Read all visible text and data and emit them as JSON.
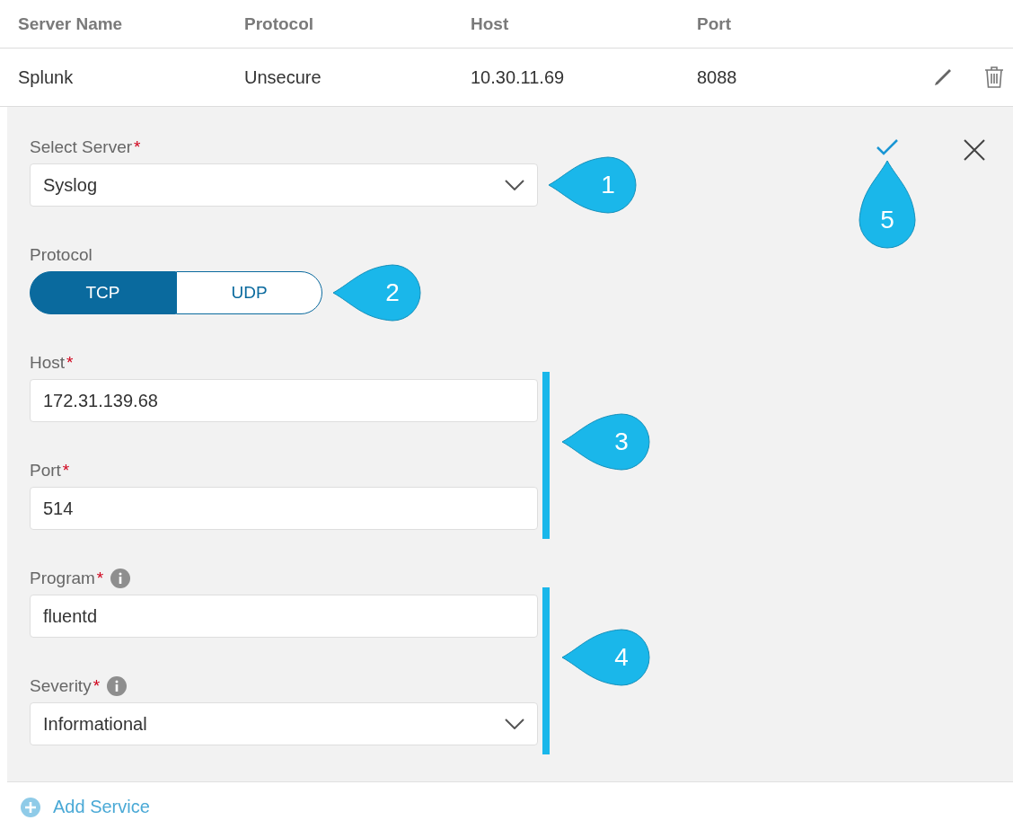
{
  "table": {
    "columns": [
      "Server Name",
      "Protocol",
      "Host",
      "Port"
    ],
    "rows": [
      {
        "cells": [
          "Splunk",
          "Unsecure",
          "10.30.11.69",
          "8088"
        ]
      }
    ]
  },
  "form": {
    "rows": [
      {
        "kind": "select",
        "label": "Select Server",
        "required_mark": "*",
        "info": false,
        "value": "Syslog",
        "callout": "1"
      },
      {
        "kind": "toggle",
        "label": "Protocol",
        "options": [
          {
            "label": "TCP",
            "selected": true
          },
          {
            "label": "UDP",
            "selected": false
          }
        ],
        "callout": "2"
      },
      {
        "kind": "group",
        "callout": "3",
        "fields": [
          {
            "kind": "text",
            "label": "Host",
            "required_mark": "*",
            "info": false,
            "value": "172.31.139.68"
          },
          {
            "kind": "text",
            "label": "Port",
            "required_mark": "*",
            "info": false,
            "value": "514"
          }
        ]
      },
      {
        "kind": "group",
        "callout": "4",
        "fields": [
          {
            "kind": "text",
            "label": "Program",
            "required_mark": "*",
            "info": true,
            "value": "fluentd"
          },
          {
            "kind": "select",
            "label": "Severity",
            "required_mark": "*",
            "info": true,
            "value": "Informational"
          }
        ]
      }
    ],
    "confirm_callout": "5"
  },
  "add_service": "Add Service"
}
